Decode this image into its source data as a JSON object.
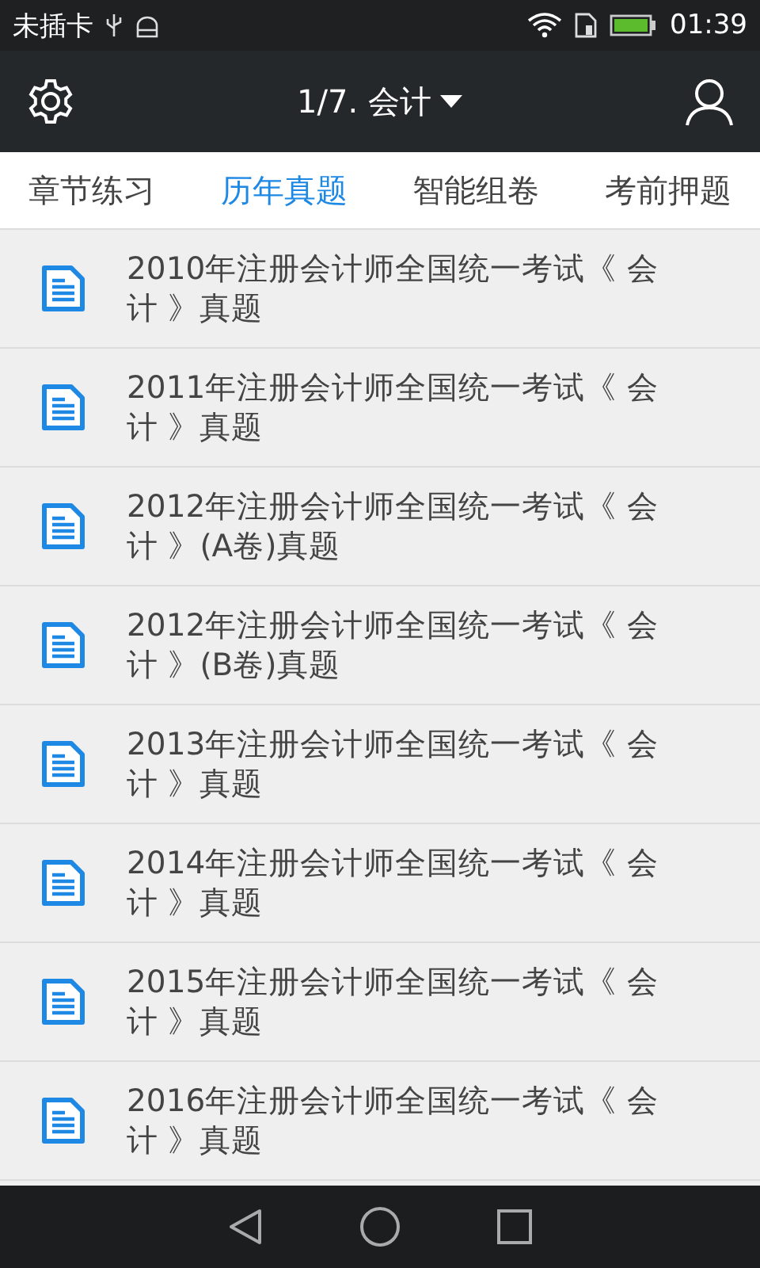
{
  "status_bar": {
    "carrier": "未插卡",
    "time": "01:39"
  },
  "app_bar": {
    "title": "1/7. 会计"
  },
  "tabs": [
    {
      "label": "章节练习",
      "selected": false
    },
    {
      "label": "历年真题",
      "selected": true
    },
    {
      "label": "智能组卷",
      "selected": false
    },
    {
      "label": "考前押题",
      "selected": false
    }
  ],
  "papers": [
    {
      "title": "2010年注册会计师全国统一考试《 会计 》真题"
    },
    {
      "title": "2011年注册会计师全国统一考试《 会计 》真题"
    },
    {
      "title": "2012年注册会计师全国统一考试《 会计 》(A卷)真题"
    },
    {
      "title": "2012年注册会计师全国统一考试《 会计 》(B卷)真题"
    },
    {
      "title": "2013年注册会计师全国统一考试《 会计 》真题"
    },
    {
      "title": "2014年注册会计师全国统一考试《 会计 》真题"
    },
    {
      "title": "2015年注册会计师全国统一考试《 会计 》真题"
    },
    {
      "title": "2016年注册会计师全国统一考试《 会计 》真题"
    }
  ]
}
